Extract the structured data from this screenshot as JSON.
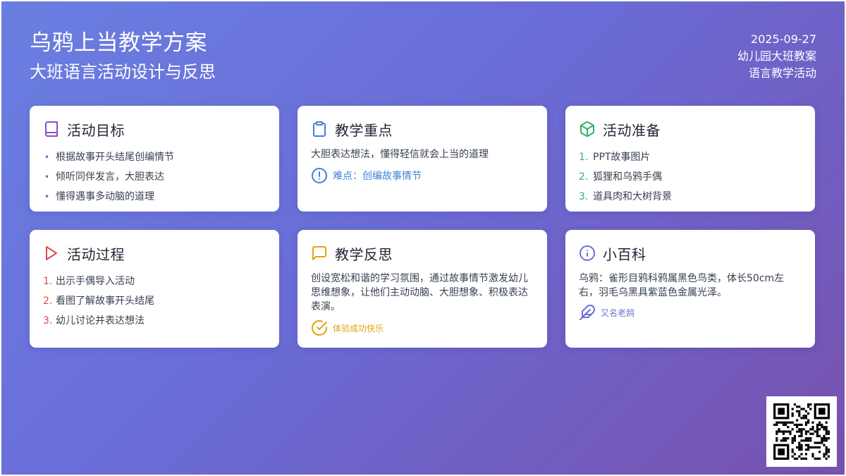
{
  "header": {
    "title": "乌鸦上当教学方案",
    "subtitle": "大班语言活动设计与反思",
    "date": "2025-09-27",
    "category": "幼儿园大班教案",
    "type": "语言教学活动"
  },
  "colors": {
    "purple": "#8e4fc7",
    "blue": "#3d83d6",
    "green": "#2fb267",
    "red": "#d94a4a",
    "yellow": "#e0a50e",
    "indigo": "#6b6fd4"
  },
  "cards": {
    "goals": {
      "title": "活动目标",
      "icon": "book-icon",
      "items": [
        "根据故事开头结尾创编情节",
        "倾听同伴发言，大胆表达",
        "懂得遇事多动脑的道理"
      ]
    },
    "focus": {
      "title": "教学重点",
      "icon": "clipboard-icon",
      "text": "大胆表达想法，懂得轻信就会上当的道理",
      "note_icon": "alert-circle-icon",
      "note": "难点：创编故事情节"
    },
    "prep": {
      "title": "活动准备",
      "icon": "box-icon",
      "items": [
        "PPT故事图片",
        "狐狸和乌鸦手偶",
        "道具肉和大树背景"
      ]
    },
    "process": {
      "title": "活动过程",
      "icon": "play-icon",
      "items": [
        "出示手偶导入活动",
        "看图了解故事开头结尾",
        "幼儿讨论并表达想法"
      ]
    },
    "reflection": {
      "title": "教学反思",
      "icon": "message-square-icon",
      "text": "创设宽松和谐的学习氛围，通过故事情节激发幼儿思维想象，让他们主动动脑、大胆想象、积极表达表演。",
      "note_icon": "check-circle-icon",
      "note": "体验成功快乐"
    },
    "wiki": {
      "title": "小百科",
      "icon": "info-icon",
      "text": "乌鸦：雀形目鸦科鸦属黑色鸟类，体长50cm左右，羽毛乌黑具紫蓝色金属光泽。",
      "note_icon": "feather-icon",
      "note": "又名老鸹"
    }
  },
  "qr": {
    "icon": "qr-code"
  }
}
